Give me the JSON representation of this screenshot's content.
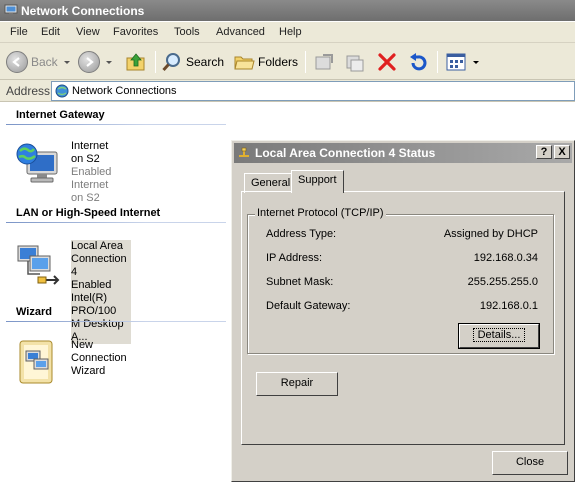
{
  "window": {
    "title": "Network Connections"
  },
  "menu": [
    "File",
    "Edit",
    "View",
    "Favorites",
    "Tools",
    "Advanced",
    "Help"
  ],
  "toolbar": {
    "back_label": "Back",
    "search_label": "Search",
    "folders_label": "Folders"
  },
  "address": {
    "label": "Address",
    "value": "Network Connections"
  },
  "groups": [
    {
      "header": "Internet Gateway",
      "items": [
        {
          "line1": "Internet on S2",
          "line2": "Enabled",
          "line3": "Internet on S2",
          "icon": "internet-gateway-icon"
        }
      ]
    },
    {
      "header": "LAN or High-Speed Internet",
      "items": [
        {
          "line1": "Local Area Connection 4",
          "line2": "Enabled",
          "line3": "Intel(R) PRO/100 M Desktop A...",
          "icon": "lan-connection-icon"
        }
      ]
    },
    {
      "header": "Wizard",
      "items": [
        {
          "line1": "New Connection Wizard",
          "icon": "connection-wizard-icon"
        }
      ]
    }
  ],
  "dialog": {
    "title": "Local Area Connection 4 Status",
    "help_button": "?",
    "close_x": "X",
    "tabs": [
      "General",
      "Support"
    ],
    "active_tab": "Support",
    "group_label": "Internet Protocol (TCP/IP)",
    "fields": [
      {
        "label": "Address Type:",
        "value": "Assigned by DHCP"
      },
      {
        "label": "IP Address:",
        "value": "192.168.0.34"
      },
      {
        "label": "Subnet Mask:",
        "value": "255.255.255.0"
      },
      {
        "label": "Default Gateway:",
        "value": "192.168.0.1"
      }
    ],
    "details_button": "Details...",
    "repair_button": "Repair",
    "close_button": "Close"
  },
  "colors": {
    "titlebar": "#7a7a7a",
    "chrome": "#ece9d8",
    "dialog_face": "#d4d0c8",
    "delete_red": "#e02020",
    "undo_blue": "#1b57c9"
  }
}
